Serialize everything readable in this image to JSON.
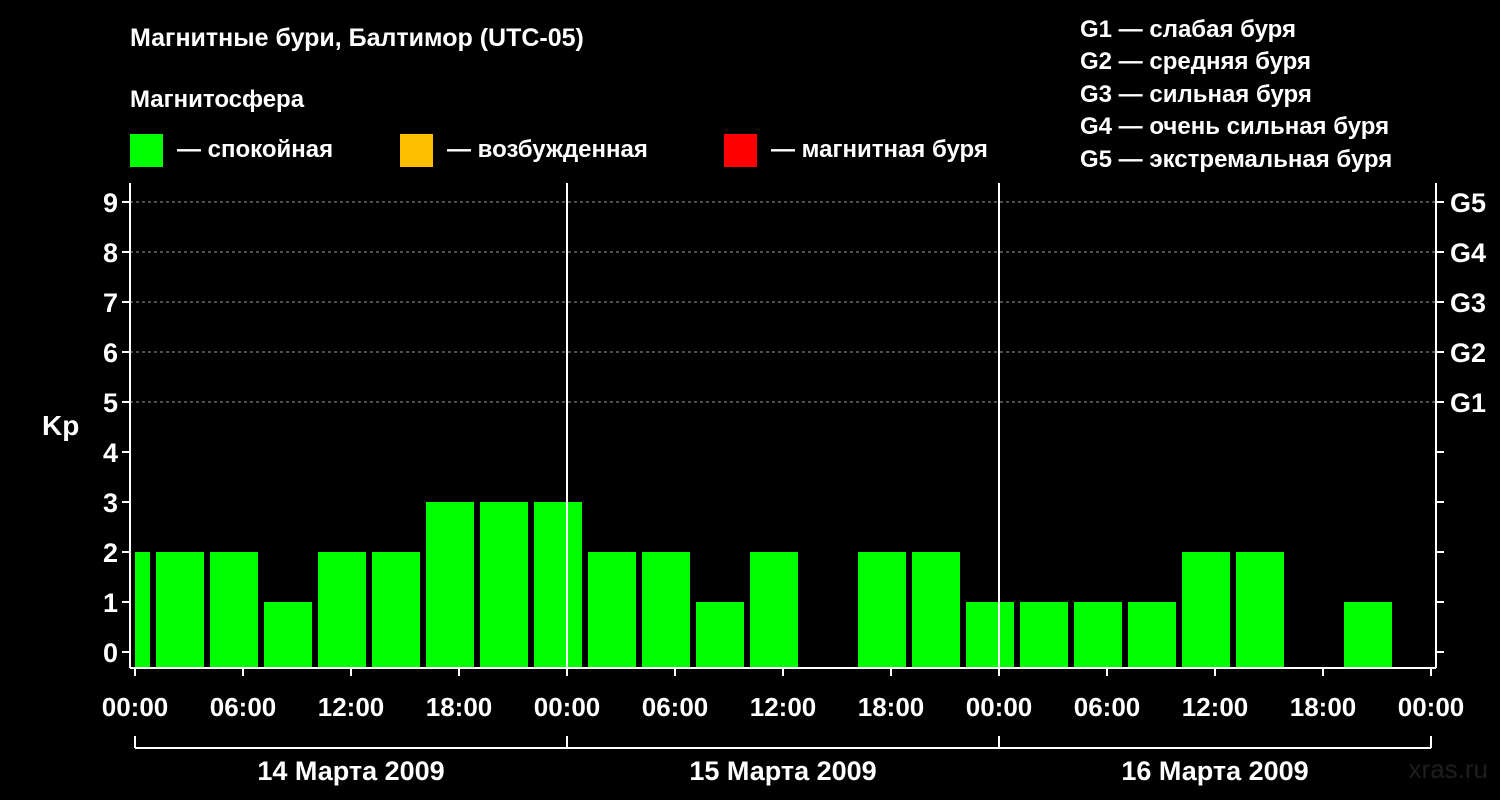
{
  "header": {
    "title": "Магнитные бури, Балтимор (UTC-05)",
    "subtitle": "Магнитосфера"
  },
  "legend": [
    {
      "label": "— спокойная",
      "color": "#00ff00"
    },
    {
      "label": "— возбужденная",
      "color": "#ffbf00"
    },
    {
      "label": "— магнитная буря",
      "color": "#ff0000"
    }
  ],
  "g_scale": [
    "G1 — слабая буря",
    "G2 — средняя буря",
    "G3 — сильная буря",
    "G4 — очень сильная буря",
    "G5 — экстремальная буря"
  ],
  "watermark": "xras.ru",
  "chart_data": {
    "type": "bar",
    "ylabel": "Kp",
    "ylim": [
      0,
      9
    ],
    "yticks": [
      "0",
      "1",
      "2",
      "3",
      "4",
      "5",
      "6",
      "7",
      "8",
      "9"
    ],
    "right_axis_labels": [
      {
        "kp": 5,
        "label": "G1"
      },
      {
        "kp": 6,
        "label": "G2"
      },
      {
        "kp": 7,
        "label": "G3"
      },
      {
        "kp": 8,
        "label": "G4"
      },
      {
        "kp": 9,
        "label": "G5"
      }
    ],
    "grid": "dashed horizontal at Kp 5–9",
    "xlim_hours": [
      0,
      72
    ],
    "x_tick_labels": [
      "00:00",
      "06:00",
      "12:00",
      "18:00",
      "00:00",
      "06:00",
      "12:00",
      "18:00",
      "00:00",
      "06:00",
      "12:00",
      "18:00",
      "00:00"
    ],
    "days": [
      "14 Марта 2009",
      "15 Марта 2009",
      "16 Марта 2009"
    ],
    "bar_color": "#00ff00",
    "bars": [
      {
        "start": 0,
        "end": 1,
        "kp": 2
      },
      {
        "start": 1,
        "end": 4,
        "kp": 2
      },
      {
        "start": 4,
        "end": 7,
        "kp": 2
      },
      {
        "start": 7,
        "end": 10,
        "kp": 1
      },
      {
        "start": 10,
        "end": 13,
        "kp": 2
      },
      {
        "start": 13,
        "end": 16,
        "kp": 2
      },
      {
        "start": 16,
        "end": 19,
        "kp": 3
      },
      {
        "start": 19,
        "end": 22,
        "kp": 3
      },
      {
        "start": 22,
        "end": 25,
        "kp": 3
      },
      {
        "start": 25,
        "end": 28,
        "kp": 2
      },
      {
        "start": 28,
        "end": 31,
        "kp": 2
      },
      {
        "start": 31,
        "end": 34,
        "kp": 1
      },
      {
        "start": 34,
        "end": 37,
        "kp": 2
      },
      {
        "start": 37,
        "end": 40,
        "kp": 0
      },
      {
        "start": 40,
        "end": 43,
        "kp": 2
      },
      {
        "start": 43,
        "end": 46,
        "kp": 2
      },
      {
        "start": 46,
        "end": 49,
        "kp": 1
      },
      {
        "start": 49,
        "end": 52,
        "kp": 1
      },
      {
        "start": 52,
        "end": 55,
        "kp": 1
      },
      {
        "start": 55,
        "end": 58,
        "kp": 1
      },
      {
        "start": 58,
        "end": 61,
        "kp": 2
      },
      {
        "start": 61,
        "end": 64,
        "kp": 2
      },
      {
        "start": 64,
        "end": 67,
        "kp": 0
      },
      {
        "start": 67,
        "end": 70,
        "kp": 1
      }
    ]
  }
}
